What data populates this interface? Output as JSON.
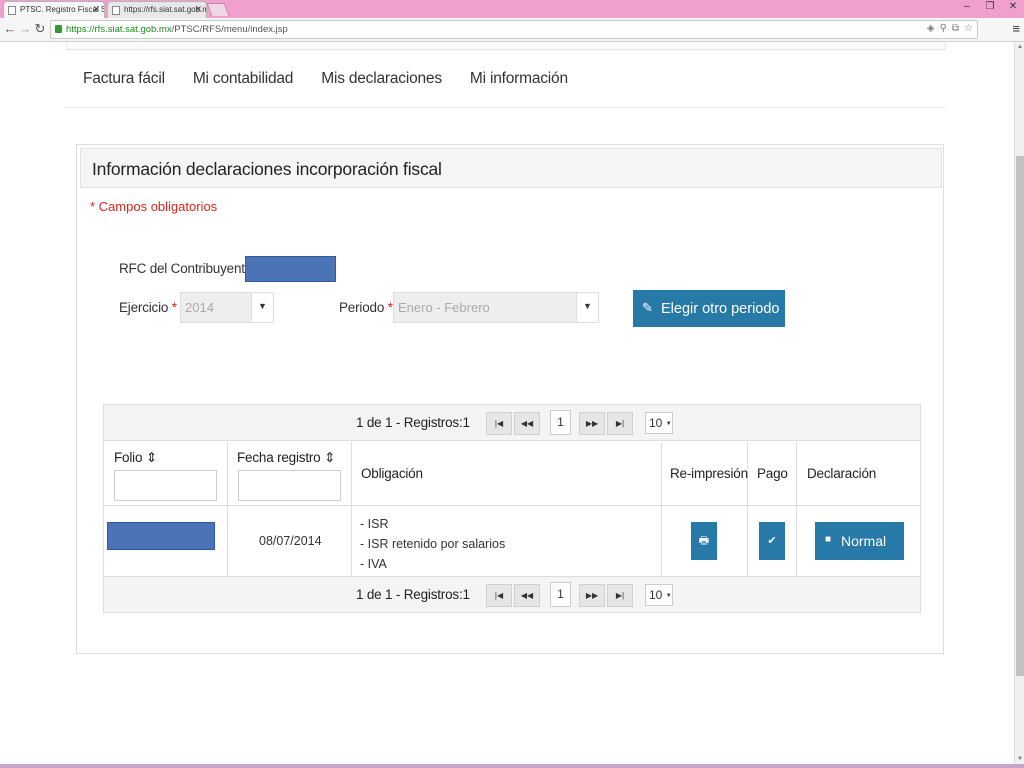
{
  "browser": {
    "tabs": [
      {
        "label": "PTSC. Registro Fiscal Simp"
      },
      {
        "label": "https://rfs.siat.sat.gob.mx"
      }
    ],
    "url_domain": "https://rfs.siat.sat.gob.mx",
    "url_path": "/PTSC/RFS/menu/index.jsp",
    "window_buttons": {
      "minimize": "–",
      "restore": "❐",
      "close": "✕"
    }
  },
  "nav": {
    "items": [
      "Factura fácil",
      "Mi contabilidad",
      "Mis declaraciones",
      "Mi información"
    ]
  },
  "panel": {
    "title": "Información declaraciones incorporación fiscal",
    "required_note": "* Campos obligatorios",
    "rfc_label": "RFC del Contribuyente: C",
    "ejercicio_label": "Ejercicio",
    "ejercicio_value": "2014",
    "periodo_label": "Periodo",
    "periodo_value": "Enero - Febrero",
    "required_mark": "*",
    "choose_period_button": "Elegir otro periodo"
  },
  "grid": {
    "pager_info": "1 de 1 - Registros:1",
    "page": "1",
    "page_size": "10",
    "headers": {
      "folio": "Folio",
      "fecha": "Fecha registro",
      "obligacion": "Obligación",
      "reimpresion": "Re-impresión",
      "pago": "Pago",
      "declaracion": "Declaración"
    },
    "row": {
      "fecha": "08/07/2014",
      "obligaciones": [
        "- ISR",
        "- ISR retenido por salarios",
        "- IVA"
      ],
      "declaracion_button": "Normal"
    }
  },
  "colors": {
    "accent": "#2779a7",
    "required": "#d9251c",
    "redaction": "#4a74b5",
    "titlebar": "#f0a0cc"
  }
}
